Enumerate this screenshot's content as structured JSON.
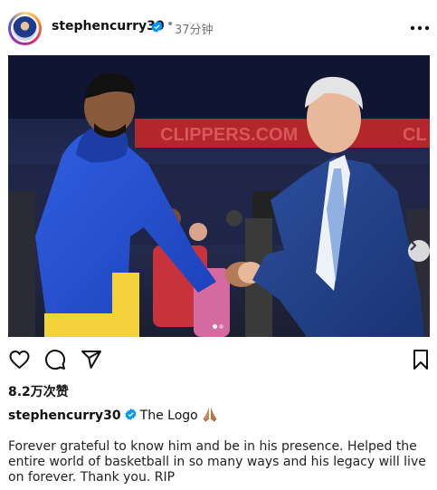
{
  "post": {
    "username": "stephencurry30",
    "dot": "•",
    "time": "37分钟",
    "likes": "8.2万次赞",
    "caption_username": "stephencurry30",
    "caption_title": "The Logo",
    "caption_body": "Forever grateful to know him and be in his presence. Helped the entire world of basketball in so many ways and his legacy will live on forever. Thank you. RIP",
    "carousel": {
      "current": 1,
      "total": 2
    }
  },
  "photo": {
    "banner_text": "CLIPPERS.COM",
    "banner_text_right": "CL"
  },
  "icons": {
    "verified": "verified-badge-icon",
    "more": "more-options-icon",
    "like": "heart-icon",
    "comment": "comment-icon",
    "share": "send-icon",
    "save": "bookmark-icon",
    "next": "chevron-right-icon",
    "pray": "praying-hands-emoji"
  },
  "colors": {
    "verified": "#0095f6",
    "text": "#111111",
    "muted": "#737373"
  }
}
